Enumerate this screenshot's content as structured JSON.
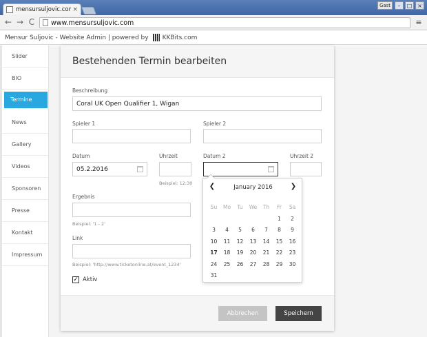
{
  "browser": {
    "tab_title": "mensursuljovic.com",
    "user_label": "Gast",
    "url": "www.mensursuljovic.com",
    "back_glyph": "←",
    "forward_glyph": "→",
    "reload_glyph": "C",
    "menu_glyph": "≡",
    "min_glyph": "–",
    "max_glyph": "□",
    "close_glyph": "×",
    "tab_close_glyph": "×"
  },
  "header": {
    "title": "Mensur Suljovic - Website Admin | powered by",
    "brand": "KKBits.com"
  },
  "sidebar": {
    "items": [
      {
        "label": "Slider"
      },
      {
        "label": "BIO"
      },
      {
        "label": "Termine"
      },
      {
        "label": "News"
      },
      {
        "label": "Gallery"
      },
      {
        "label": "Videos"
      },
      {
        "label": "Sponsoren"
      },
      {
        "label": "Presse"
      },
      {
        "label": "Kontakt"
      },
      {
        "label": "Impressum"
      }
    ],
    "active_index": 2
  },
  "modal": {
    "title": "Bestehenden Termin bearbeiten",
    "fields": {
      "beschreibung": {
        "label": "Beschreibung",
        "value": "Coral UK Open Qualifier 1, Wigan"
      },
      "spieler1": {
        "label": "Spieler 1",
        "value": ""
      },
      "spieler2": {
        "label": "Spieler 2",
        "value": ""
      },
      "datum": {
        "label": "Datum",
        "value": "05.2.2016"
      },
      "uhrzeit": {
        "label": "Uhrzeit",
        "value": "",
        "hint": "Beispiel: 12:30"
      },
      "datum2": {
        "label": "Datum 2",
        "value": ""
      },
      "uhrzeit2": {
        "label": "Uhrzeit 2",
        "value": ""
      },
      "ergebnis": {
        "label": "Ergebnis",
        "value": "",
        "hint": "Beispiel: '1 - 2'"
      },
      "link": {
        "label": "Link",
        "value": "",
        "hint": "Beispiel: 'http://www.ticketonline.at/event_1234'"
      }
    },
    "aktiv": {
      "label": "Aktiv",
      "checked": true,
      "check_glyph": "✓"
    },
    "buttons": {
      "cancel": "Abbrechen",
      "save": "Speichern"
    }
  },
  "datepicker": {
    "month_label": "January 2016",
    "prev_glyph": "❮",
    "next_glyph": "❯",
    "weekdays": [
      "Su",
      "Mo",
      "Tu",
      "We",
      "Th",
      "Fr",
      "Sa"
    ],
    "weeks": [
      [
        "",
        "",
        "",
        "",
        "",
        "1",
        "2"
      ],
      [
        "3",
        "4",
        "5",
        "6",
        "7",
        "8",
        "9"
      ],
      [
        "10",
        "11",
        "12",
        "13",
        "14",
        "15",
        "16"
      ],
      [
        "17",
        "18",
        "19",
        "20",
        "21",
        "22",
        "23"
      ],
      [
        "24",
        "25",
        "26",
        "27",
        "28",
        "29",
        "30"
      ],
      [
        "31",
        "",
        "",
        "",
        "",
        "",
        ""
      ]
    ],
    "highlighted_day": "17"
  }
}
